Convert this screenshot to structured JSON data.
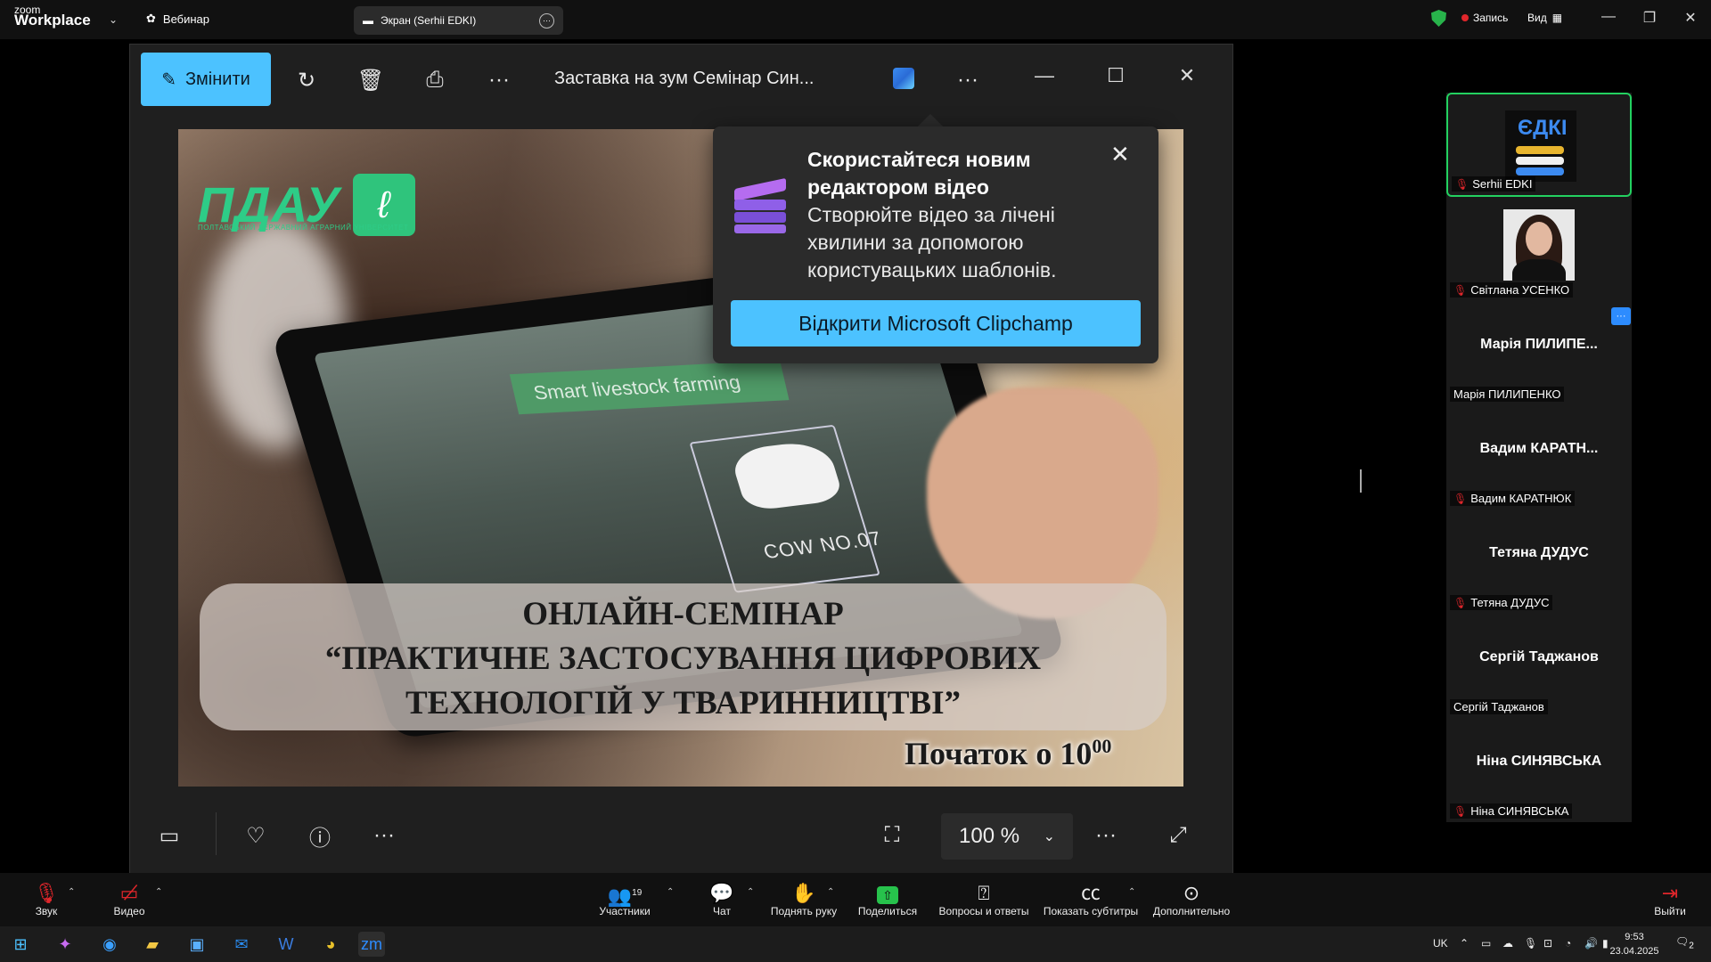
{
  "zoom_top": {
    "logo_small": "zoom",
    "logo_big": "Workplace",
    "webinar_label": "Вебинар",
    "screen_tab_label": "Экран (Serhii EDKI)",
    "record_label": "Запись",
    "view_label": "Вид",
    "icons": [
      "chevron-down-icon",
      "webinar-icon",
      "screen-share-icon",
      "more-icon",
      "shield-icon",
      "grid-icon",
      "minimize-icon",
      "restore-icon",
      "close-icon"
    ]
  },
  "photos": {
    "edit_label": "Змінити",
    "title": "Заставка  на зум Семінар Син...",
    "zoom_level": "100 %",
    "icons": [
      "rotate-icon",
      "trash-icon",
      "print-icon",
      "more-icon",
      "designer-icon",
      "filmstrip-icon",
      "heart-icon",
      "info-icon",
      "fit-icon",
      "expand-icon"
    ]
  },
  "image": {
    "logo_text": "ПДАУ",
    "logo_sub": "ПОЛТАВСЬКИЙ ДЕРЖАВНИЙ АГРАРНИЙ УНІВЕРСИТЕТ",
    "tablet_band": "Smart livestock farming",
    "cow_label": "COW NO.07",
    "seminar_line1": "ОНЛАЙН-СЕМІНАР",
    "seminar_line2": "“ПРАКТИЧНЕ ЗАСТОСУВАННЯ ЦИФРОВИХ",
    "seminar_line3": "ТЕХНОЛОГІЙ У ТВАРИННИЦТВІ”",
    "start_text": "Початок о 10",
    "start_sup": "00"
  },
  "popup": {
    "title": "Скористайтеся новим редактором відео",
    "body": "Створюйте відео за лічені хвилини за допомогою користувацьких шаблонів.",
    "button": "Відкрити Microsoft Clipchamp"
  },
  "participants": [
    {
      "big": "",
      "small": "Serhii EDKI",
      "muted": true
    },
    {
      "big": "",
      "small": "Світлана УСЕНКО",
      "muted": true
    },
    {
      "big": "Марія  ПИЛИПЕ...",
      "small": "Марія ПИЛИПЕНКО",
      "muted": false
    },
    {
      "big": "Вадим  КАРАТН...",
      "small": "Вадим КАРАТНЮК",
      "muted": true
    },
    {
      "big": "Тетяна ДУДУС",
      "small": "Тетяна ДУДУС",
      "muted": true
    },
    {
      "big": "Сергій Таджанов",
      "small": "Сергій Таджанов",
      "muted": false
    },
    {
      "big": "Ніна СИНЯВСЬКА",
      "small": "Ніна СИНЯВСЬКА",
      "muted": true
    }
  ],
  "edki_text": "ЄДКІ",
  "zoom_bottom": {
    "audio": "Звук",
    "video": "Видео",
    "participants": "Участники",
    "participants_count": "19",
    "chat": "Чат",
    "raise_hand": "Поднять руку",
    "share": "Поделиться",
    "qa": "Вопросы и ответы",
    "captions": "Показать субтитры",
    "more": "Дополнительно",
    "leave": "Выйти"
  },
  "taskbar": {
    "lang": "UK",
    "time": "9:53",
    "date": "23.04.2025",
    "notifications": "2"
  }
}
